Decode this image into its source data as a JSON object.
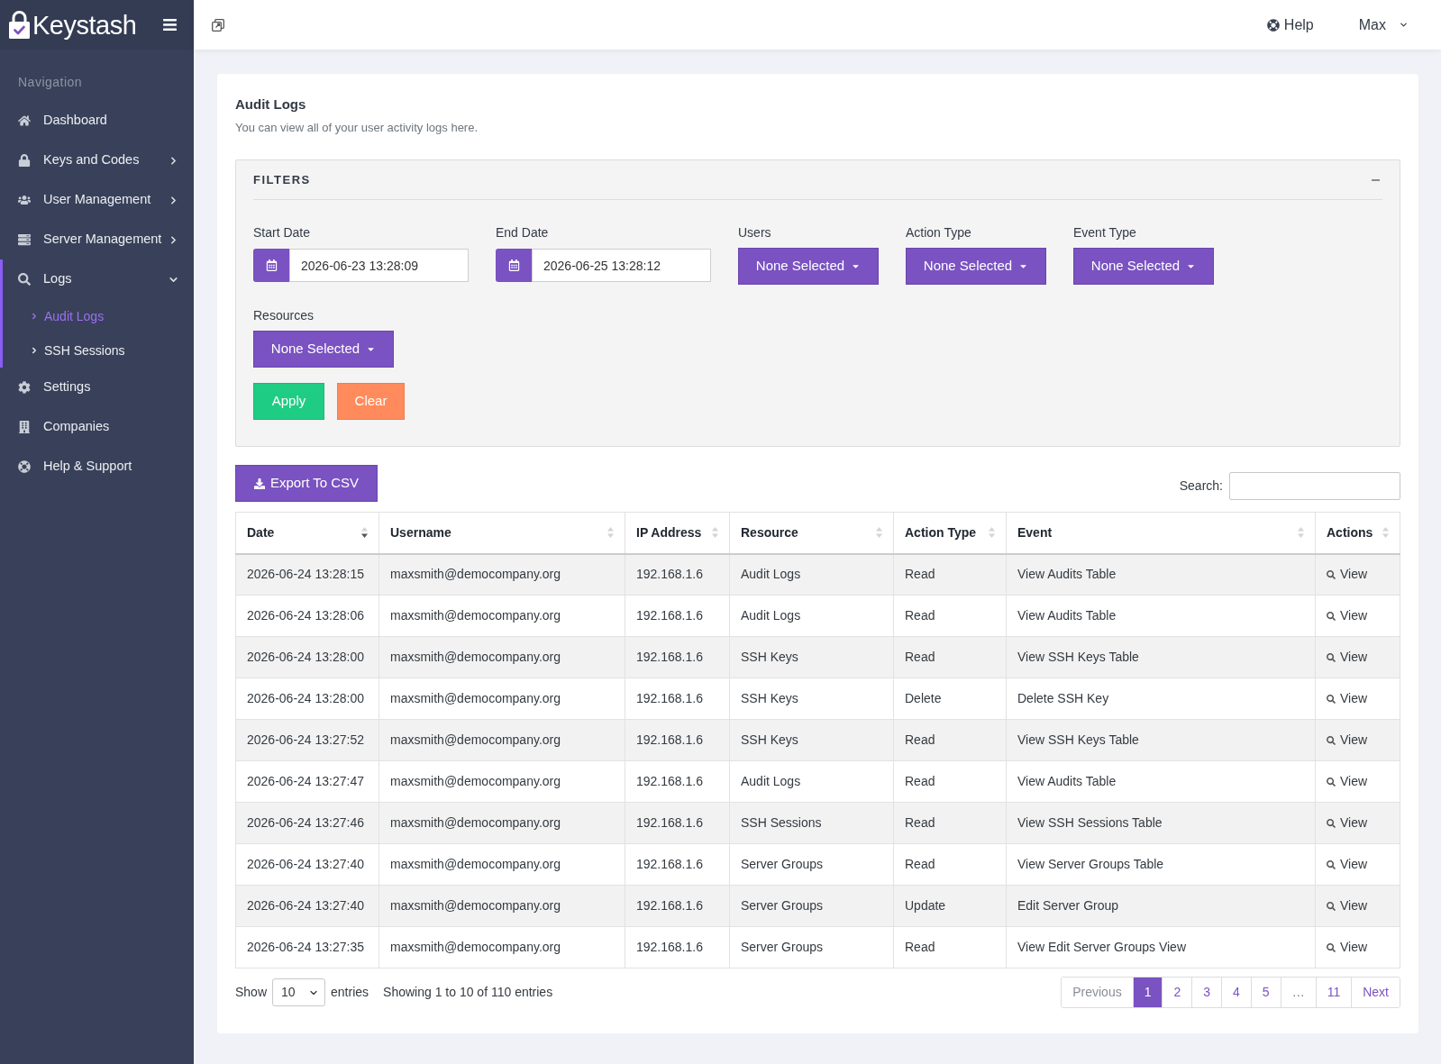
{
  "brand": {
    "name": "Keystash"
  },
  "header": {
    "help": "Help",
    "user": "Max"
  },
  "sidebar": {
    "heading": "Navigation",
    "items": [
      {
        "label": "Dashboard",
        "kind": "link",
        "selected": false
      },
      {
        "label": "Keys and Codes",
        "kind": "group",
        "selected": false,
        "expanded": false
      },
      {
        "label": "User Management",
        "kind": "group",
        "selected": false,
        "expanded": false
      },
      {
        "label": "Server Management",
        "kind": "group",
        "selected": false,
        "expanded": false
      },
      {
        "label": "Logs",
        "kind": "group",
        "selected": true,
        "expanded": true,
        "children": [
          {
            "label": "Audit Logs",
            "selected": true
          },
          {
            "label": "SSH Sessions",
            "selected": false
          }
        ]
      },
      {
        "label": "Settings",
        "kind": "link",
        "selected": false
      },
      {
        "label": "Companies",
        "kind": "link",
        "selected": false
      },
      {
        "label": "Help & Support",
        "kind": "link",
        "selected": false
      }
    ]
  },
  "page": {
    "title": "Audit Logs",
    "subtitle": "You can view all of your user activity logs here."
  },
  "filters": {
    "title": "FILTERS",
    "expanded": true,
    "fields": [
      {
        "label": "Start Date",
        "kind": "date",
        "value": "2026-06-23 13:28:09"
      },
      {
        "label": "End Date",
        "kind": "date",
        "value": "2026-06-25 13:28:12"
      },
      {
        "label": "Users",
        "kind": "dropdown",
        "value": "None Selected"
      },
      {
        "label": "Action Type",
        "kind": "dropdown",
        "value": "None Selected"
      },
      {
        "label": "Event Type",
        "kind": "dropdown",
        "value": "None Selected"
      },
      {
        "label": "Resources",
        "kind": "dropdown",
        "value": "None Selected"
      }
    ],
    "buttons": [
      {
        "label": "Apply",
        "kind": "apply"
      },
      {
        "label": "Clear",
        "kind": "clear"
      }
    ]
  },
  "toolbar": {
    "export": "Export To CSV",
    "search_label": "Search:"
  },
  "table": {
    "columns": [
      {
        "label": "Date",
        "sorted": true
      },
      {
        "label": "Username",
        "sorted": false
      },
      {
        "label": "IP Address",
        "sorted": false
      },
      {
        "label": "Resource",
        "sorted": false
      },
      {
        "label": "Action Type",
        "sorted": false
      },
      {
        "label": "Event",
        "sorted": false
      },
      {
        "label": "Actions",
        "sorted": false
      }
    ],
    "rows": [
      {
        "cells": [
          "2026-06-24 13:28:15",
          "maxsmith@democompany.org",
          "192.168.1.6",
          "Audit Logs",
          "Read",
          "View Audits Table"
        ],
        "action": "View"
      },
      {
        "cells": [
          "2026-06-24 13:28:06",
          "maxsmith@democompany.org",
          "192.168.1.6",
          "Audit Logs",
          "Read",
          "View Audits Table"
        ],
        "action": "View"
      },
      {
        "cells": [
          "2026-06-24 13:28:00",
          "maxsmith@democompany.org",
          "192.168.1.6",
          "SSH Keys",
          "Read",
          "View SSH Keys Table"
        ],
        "action": "View"
      },
      {
        "cells": [
          "2026-06-24 13:28:00",
          "maxsmith@democompany.org",
          "192.168.1.6",
          "SSH Keys",
          "Delete",
          "Delete SSH Key"
        ],
        "action": "View"
      },
      {
        "cells": [
          "2026-06-24 13:27:52",
          "maxsmith@democompany.org",
          "192.168.1.6",
          "SSH Keys",
          "Read",
          "View SSH Keys Table"
        ],
        "action": "View"
      },
      {
        "cells": [
          "2026-06-24 13:27:47",
          "maxsmith@democompany.org",
          "192.168.1.6",
          "Audit Logs",
          "Read",
          "View Audits Table"
        ],
        "action": "View"
      },
      {
        "cells": [
          "2026-06-24 13:27:46",
          "maxsmith@democompany.org",
          "192.168.1.6",
          "SSH Sessions",
          "Read",
          "View SSH Sessions Table"
        ],
        "action": "View"
      },
      {
        "cells": [
          "2026-06-24 13:27:40",
          "maxsmith@democompany.org",
          "192.168.1.6",
          "Server Groups",
          "Read",
          "View Server Groups Table"
        ],
        "action": "View"
      },
      {
        "cells": [
          "2026-06-24 13:27:40",
          "maxsmith@democompany.org",
          "192.168.1.6",
          "Server Groups",
          "Update",
          "Edit Server Group"
        ],
        "action": "View"
      },
      {
        "cells": [
          "2026-06-24 13:27:35",
          "maxsmith@democompany.org",
          "192.168.1.6",
          "Server Groups",
          "Read",
          "View Edit Server Groups View"
        ],
        "action": "View"
      }
    ]
  },
  "footer": {
    "show": "Show",
    "page_size": "10",
    "entries": "entries",
    "info": "Showing 1 to 10 of 110 entries",
    "pages": [
      {
        "label": "Previous",
        "kind": "prev",
        "selected": false,
        "disabled": true
      },
      {
        "label": "1",
        "kind": "page",
        "selected": true,
        "disabled": false
      },
      {
        "label": "2",
        "kind": "page",
        "selected": false,
        "disabled": false
      },
      {
        "label": "3",
        "kind": "page",
        "selected": false,
        "disabled": false
      },
      {
        "label": "4",
        "kind": "page",
        "selected": false,
        "disabled": false
      },
      {
        "label": "5",
        "kind": "page",
        "selected": false,
        "disabled": false
      },
      {
        "label": "…",
        "kind": "ellipsis",
        "selected": false,
        "disabled": false
      },
      {
        "label": "11",
        "kind": "page",
        "selected": false,
        "disabled": false
      },
      {
        "label": "Next",
        "kind": "next",
        "selected": false,
        "disabled": false
      }
    ]
  }
}
